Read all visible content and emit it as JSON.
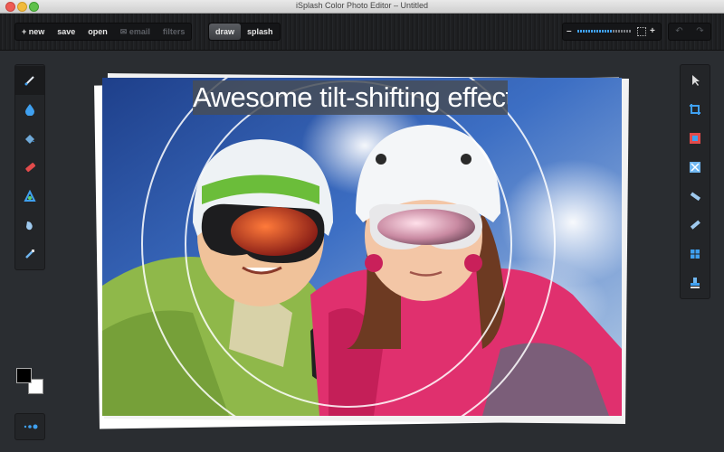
{
  "window": {
    "title": "iSplash Color Photo Editor  – Untitled"
  },
  "toolbar": {
    "file_buttons": [
      {
        "label": "+  new",
        "enabled": true
      },
      {
        "label": "save",
        "enabled": true
      },
      {
        "label": "open",
        "enabled": true
      },
      {
        "label": "✉  email",
        "enabled": false
      },
      {
        "label": "filters",
        "enabled": false
      }
    ],
    "mode_buttons": [
      {
        "label": "draw",
        "active": true
      },
      {
        "label": "splash",
        "active": false
      }
    ],
    "zoom": {
      "minus_label": "–",
      "plus_label": "+",
      "level": 0.65
    },
    "undo_icon": "undo-arrow-icon",
    "redo_icon": "redo-arrow-icon"
  },
  "left_tools": [
    {
      "name": "brush-tool",
      "icon": "brush-icon",
      "active": true
    },
    {
      "name": "water-drop-tool",
      "icon": "drop-icon",
      "active": false
    },
    {
      "name": "fill-tool",
      "icon": "paint-bucket-icon",
      "active": false
    },
    {
      "name": "eraser-tool",
      "icon": "eraser-icon",
      "active": false
    },
    {
      "name": "color-tool",
      "icon": "tricolor-icon",
      "active": false
    },
    {
      "name": "smudge-tool",
      "icon": "smudge-icon",
      "active": false
    },
    {
      "name": "eyedropper-tool",
      "icon": "eyedropper-icon",
      "active": false
    }
  ],
  "right_tools": [
    {
      "name": "pointer-tool",
      "icon": "cursor-icon"
    },
    {
      "name": "crop-tool",
      "icon": "crop-icon"
    },
    {
      "name": "frame-tool",
      "icon": "frame-icon"
    },
    {
      "name": "effects-tool",
      "icon": "effects-icon"
    },
    {
      "name": "tilt-shift-linear-tool",
      "icon": "linear-blur-icon"
    },
    {
      "name": "tilt-shift-tool",
      "icon": "tilt-blur-icon"
    },
    {
      "name": "window-tool",
      "icon": "window-icon"
    },
    {
      "name": "stamp-tool",
      "icon": "stamp-icon"
    }
  ],
  "colors": {
    "foreground": "#000000",
    "background": "#ffffff",
    "accent": "#3fa0f0"
  },
  "caption": {
    "text": "Awesome tilt-shifting effects!"
  },
  "canvas": {
    "subject": "two-children-in-ski-helmets-and-goggles",
    "overlay": "tilt-shift-circles"
  }
}
